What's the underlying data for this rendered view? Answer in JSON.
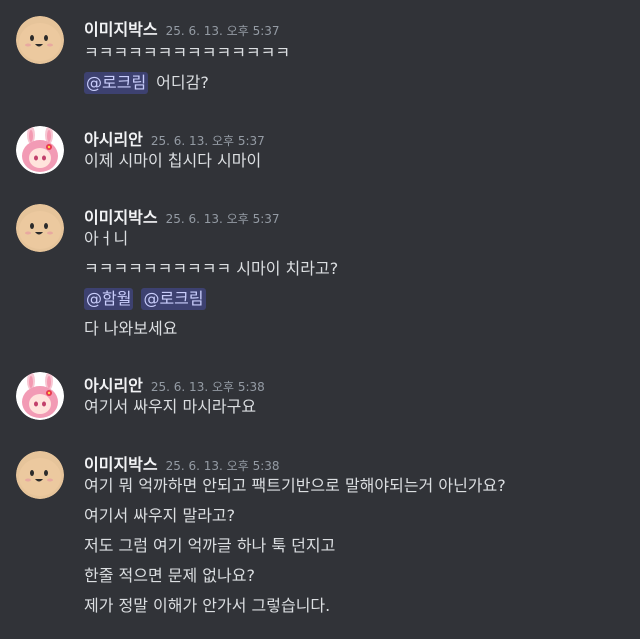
{
  "colors": {
    "background": "#313338",
    "username": "#f2f3f5",
    "timestamp": "#949ba4",
    "text": "#dbdee1",
    "mention_bg": "#3c4270",
    "mention_text": "#c9cdfb",
    "potato_avatar": "#e6c49a"
  },
  "messages": [
    {
      "author": "이미지박스",
      "avatar": "potato-face-icon",
      "time": "25. 6. 13. 오후 5:37",
      "lines": {
        "l1": "ㅋㅋㅋㅋㅋㅋㅋㅋㅋㅋㅋㅋㅋㅋ",
        "l2_mention": "@로크림",
        "l2_text": "어디감?"
      }
    },
    {
      "author": "아시리안",
      "avatar": "bunny-girl-icon",
      "time": "25. 6. 13. 오후 5:37",
      "lines": {
        "l1": "이제 시마이 칩시다 시마이"
      }
    },
    {
      "author": "이미지박스",
      "avatar": "potato-face-icon",
      "time": "25. 6. 13. 오후 5:37",
      "lines": {
        "l1": "아ㅓ니",
        "l2": "ㅋㅋㅋㅋㅋㅋㅋㅋㅋㅋ 시마이 치라고?",
        "l3_mention_a": "@함월",
        "l3_mention_b": "@로크림",
        "l4": "다 나와보세요"
      }
    },
    {
      "author": "아시리안",
      "avatar": "bunny-girl-icon",
      "time": "25. 6. 13. 오후 5:38",
      "lines": {
        "l1": "여기서 싸우지 마시라구요"
      }
    },
    {
      "author": "이미지박스",
      "avatar": "potato-face-icon",
      "time": "25. 6. 13. 오후 5:38",
      "lines": {
        "l1": "여기 뭐 억까하면 안되고 팩트기반으로 말해야되는거 아닌가요?",
        "l2": "여기서 싸우지 말라고?",
        "l3": "저도 그럼 여기 억까글 하나 툭 던지고",
        "l4": "한줄 적으면 문제 없나요?",
        "l5": "제가 정말 이해가 안가서 그렇습니다."
      }
    }
  ]
}
